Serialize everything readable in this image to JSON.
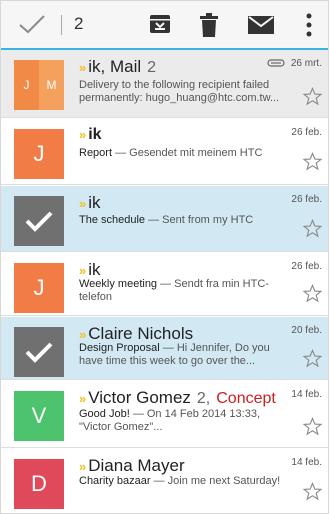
{
  "toolbar": {
    "selected_count": "2",
    "icons": [
      "checkmark-icon",
      "archive-icon",
      "delete-icon",
      "mark-read-icon",
      "more-icon"
    ],
    "accent_color": "#38b4e4"
  },
  "emails": [
    {
      "avatar": {
        "type": "split",
        "letters": [
          "J",
          "M"
        ],
        "colors": [
          "#f08a46",
          "#f4a15e"
        ]
      },
      "sender": "ik, Mail",
      "thread_count": "2",
      "has_attachment": true,
      "date": "26 mrt.",
      "snippet_subject": "",
      "snippet_body": "Delivery to the following recipient failed permanently: hugo_huang@htc.com.tw..."
    },
    {
      "avatar": {
        "type": "letter",
        "letters": [
          "J"
        ],
        "colors": [
          "#f27c45"
        ]
      },
      "sender": "ik",
      "date": "26 feb.",
      "snippet_subject": "Report",
      "snippet_body": " — Gesendet mit meinem HTC"
    },
    {
      "avatar": {
        "type": "checked"
      },
      "sender": "ik",
      "date": "26 feb.",
      "snippet_subject": "The schedule",
      "snippet_body": " — Sent from my HTC",
      "selected": true
    },
    {
      "avatar": {
        "type": "letter",
        "letters": [
          "J"
        ],
        "colors": [
          "#f27c45"
        ]
      },
      "sender": "ik",
      "date": "26 feb.",
      "snippet_subject": "Weekly meeting",
      "snippet_body": " — Sendt fra min HTC-telefon"
    },
    {
      "avatar": {
        "type": "checked"
      },
      "sender": "Claire Nichols",
      "date": "20 feb.",
      "snippet_subject": "Design Proposal",
      "snippet_body": " — Hi Jennifer, Do you have time this week to go over the...",
      "selected": true
    },
    {
      "avatar": {
        "type": "letter",
        "letters": [
          "V"
        ],
        "colors": [
          "#4dc36d"
        ]
      },
      "sender": "Victor Gomez",
      "thread_count": "2,",
      "label": "Concept",
      "label_color": "#cc1f1f",
      "date": "14 feb.",
      "snippet_subject": "Good Job!",
      "snippet_body": " — On 14 Feb 2014 13:33, \"Victor Gomez\"..."
    },
    {
      "avatar": {
        "type": "letter",
        "letters": [
          "D"
        ],
        "colors": [
          "#e0495a"
        ]
      },
      "sender": "Diana Mayer",
      "date": "14 feb.",
      "snippet_subject": "Charity bazaar",
      "snippet_body": " — Join me next Saturday!"
    }
  ]
}
